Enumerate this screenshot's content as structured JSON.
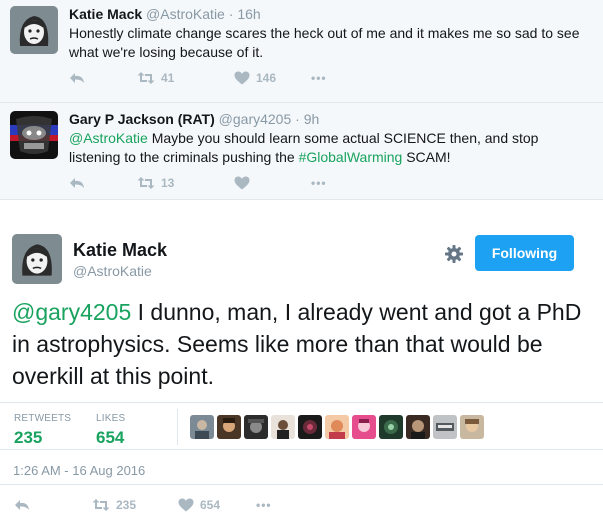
{
  "tweets": [
    {
      "name": "Katie Mack",
      "handle": "@AstroKatie",
      "sep": "·",
      "time": "16h",
      "text": "Honestly climate change scares the heck out of me and it makes me so sad to see what we're losing because of it.",
      "retweets": "41",
      "likes": "146",
      "more": "•••"
    },
    {
      "name": "Gary P Jackson (RAT)",
      "handle": "@gary4205",
      "sep": "·",
      "time": "9h",
      "mention": "@AstroKatie",
      "text_a": " Maybe you should learn some actual SCIENCE then, and stop listening to the criminals pushing the ",
      "hashtag": "#GlobalWarming",
      "text_b": " SCAM!",
      "retweets": "13",
      "more": "•••"
    }
  ],
  "main": {
    "name": "Katie Mack",
    "handle": "@AstroKatie",
    "follow_label": "Following",
    "mention": "@gary4205",
    "text": " I dunno, man, I already went and got a PhD in astrophysics. Seems like more than that would be overkill at this point.",
    "retweets_label": "RETWEETS",
    "retweets": "235",
    "likes_label": "LIKES",
    "likes": "654",
    "timestamp": "1:26 AM - 16 Aug 2016",
    "action_retweets": "235",
    "action_likes": "654",
    "more": "•••"
  },
  "colors": {
    "accent": "#1da1f2",
    "green": "#19a35f",
    "muted": "#8899a6",
    "heart": "#aab8c2"
  }
}
